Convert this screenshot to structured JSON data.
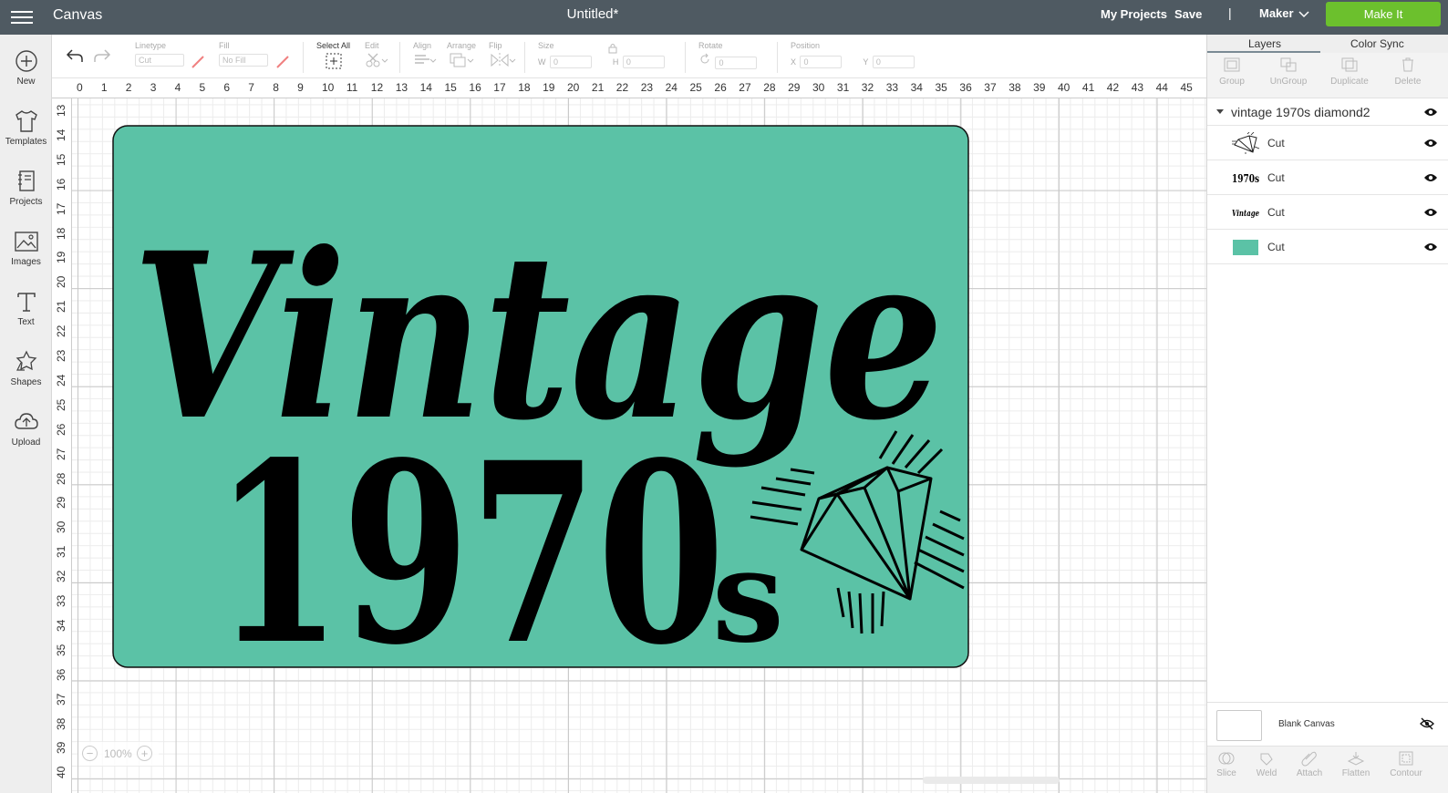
{
  "topbar": {
    "app_name": "Canvas",
    "doc_title": "Untitled*",
    "my_projects": "My Projects",
    "save": "Save",
    "separator": "|",
    "machine": "Maker",
    "make_it": "Make It",
    "bg_color": "#4f5a62",
    "make_it_color": "#6cc02d"
  },
  "sidebar": {
    "items": [
      {
        "label": "New",
        "icon": "plus-circle-icon"
      },
      {
        "label": "Templates",
        "icon": "tshirt-icon"
      },
      {
        "label": "Projects",
        "icon": "notebook-icon"
      },
      {
        "label": "Images",
        "icon": "image-icon"
      },
      {
        "label": "Text",
        "icon": "text-icon"
      },
      {
        "label": "Shapes",
        "icon": "shapes-icon"
      },
      {
        "label": "Upload",
        "icon": "cloud-upload-icon"
      }
    ]
  },
  "toolbar": {
    "linetype_label": "Linetype",
    "linetype_value": "Cut",
    "fill_label": "Fill",
    "fill_value": "No Fill",
    "select_all": "Select All",
    "edit": "Edit",
    "align": "Align",
    "arrange": "Arrange",
    "flip": "Flip",
    "size": "Size",
    "w": "W",
    "w_value": "0",
    "h": "H",
    "h_value": "0",
    "rotate": "Rotate",
    "rotate_value": "0",
    "position": "Position",
    "x": "X",
    "x_value": "0",
    "y": "Y",
    "y_value": "0"
  },
  "rulers": {
    "top": [
      "0",
      "1",
      "2",
      "3",
      "4",
      "5",
      "6",
      "7",
      "8",
      "9",
      "10",
      "11",
      "12",
      "13",
      "14",
      "15",
      "16",
      "17",
      "18",
      "19",
      "20",
      "21",
      "22",
      "23",
      "24",
      "25",
      "26",
      "27",
      "28",
      "29",
      "30",
      "31",
      "32",
      "33",
      "34",
      "35",
      "36",
      "37",
      "38",
      "39",
      "40",
      "41",
      "42",
      "43",
      "44",
      "45"
    ],
    "left": [
      "13",
      "14",
      "15",
      "16",
      "17",
      "18",
      "19",
      "20",
      "21",
      "22",
      "23",
      "24",
      "25",
      "26",
      "27",
      "28",
      "29",
      "30",
      "31",
      "32",
      "33",
      "34",
      "35",
      "36",
      "37",
      "38",
      "39",
      "40"
    ]
  },
  "design": {
    "word": "Vintage",
    "year": "1970",
    "suffix": "s",
    "bg_color": "#5bc2a6",
    "ink_color": "#000000"
  },
  "zoom": {
    "minus": "−",
    "value": "100%",
    "plus": "+"
  },
  "right_panel": {
    "tabs": [
      "Layers",
      "Color Sync"
    ],
    "tools": [
      "Group",
      "UnGroup",
      "Duplicate",
      "Delete"
    ],
    "group_name": "vintage 1970s diamond2",
    "layers": [
      {
        "op": "Cut",
        "thumb": "diamond-thumb"
      },
      {
        "op": "Cut",
        "thumb": "1970s-thumb",
        "thumb_text": "1970s"
      },
      {
        "op": "Cut",
        "thumb": "vintage-thumb",
        "thumb_text": "Vintage"
      },
      {
        "op": "Cut",
        "thumb": "teal-rect-thumb",
        "color": "#5bc2a6"
      }
    ],
    "blank_canvas": "Blank Canvas",
    "bottom_tools": [
      "Slice",
      "Weld",
      "Attach",
      "Flatten",
      "Contour"
    ]
  }
}
